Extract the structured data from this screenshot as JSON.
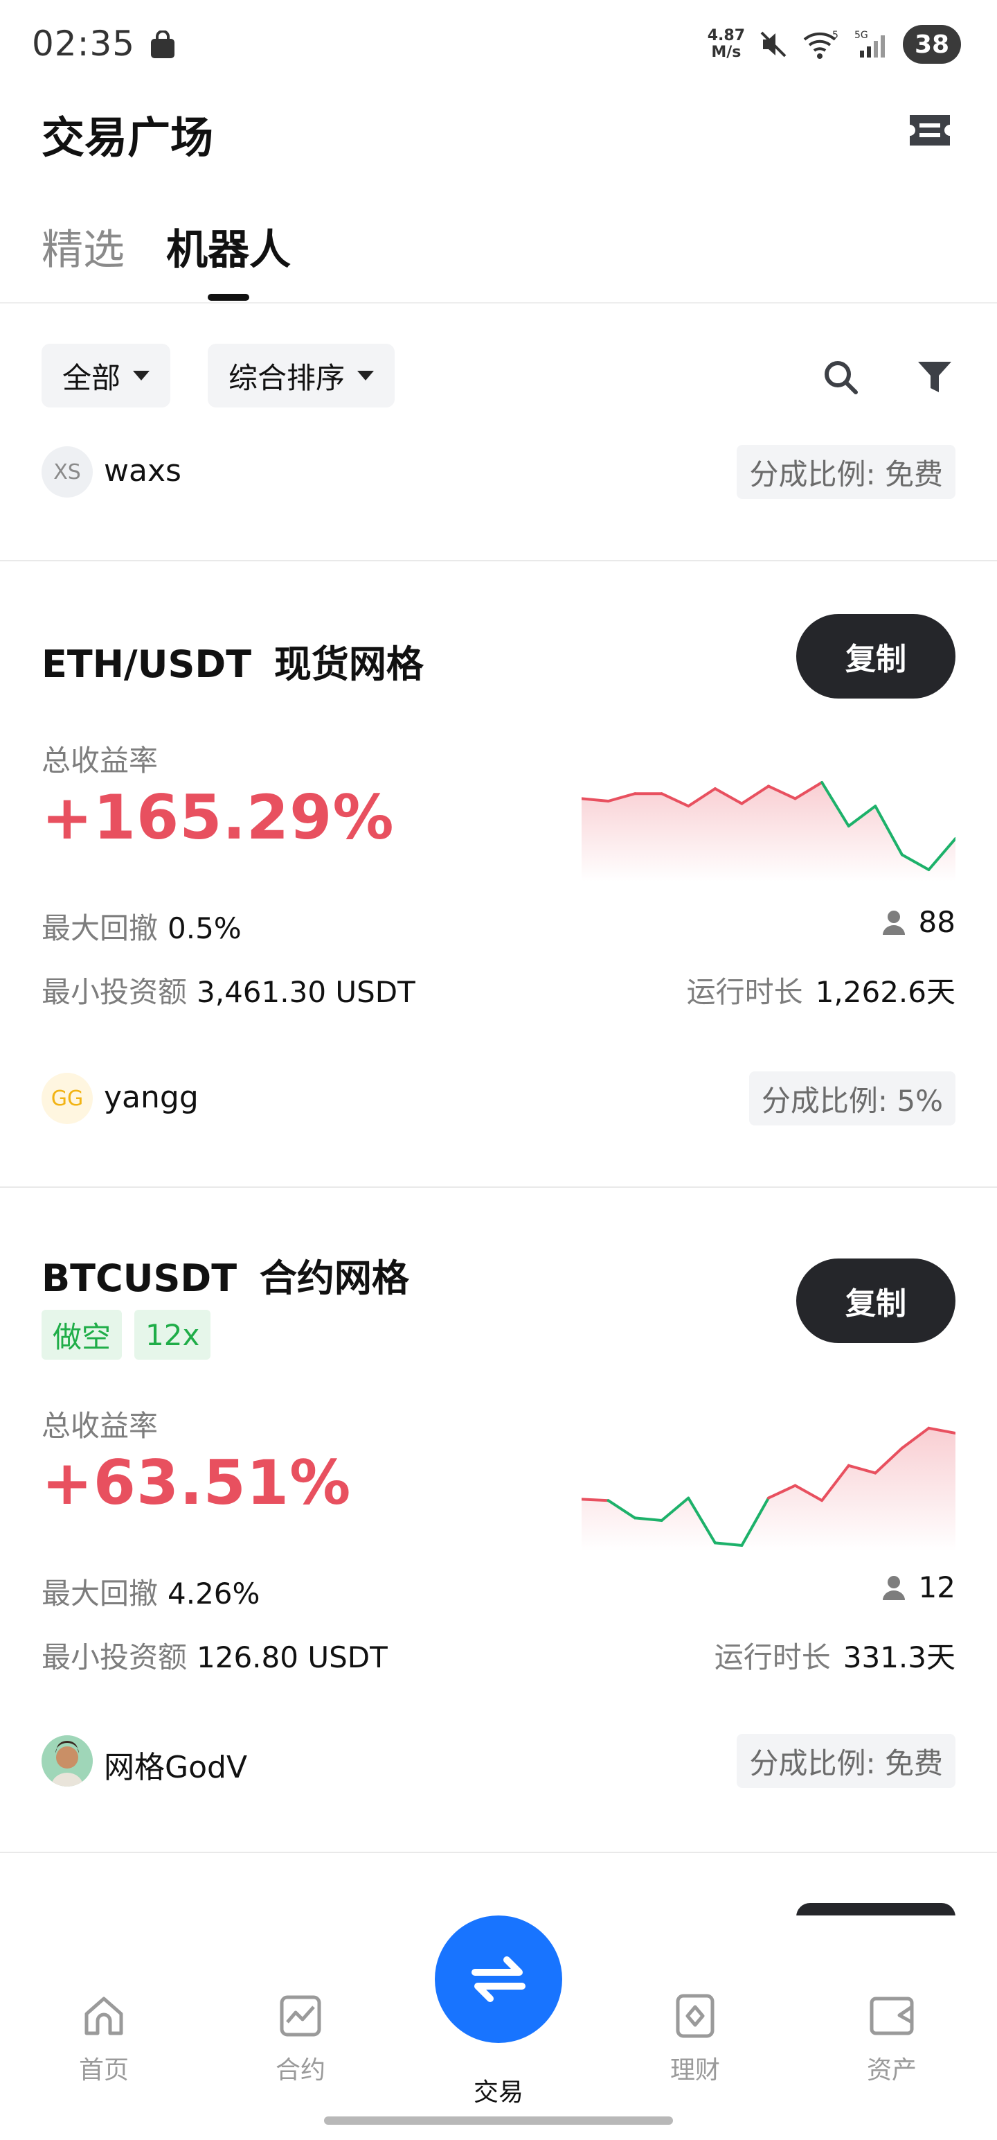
{
  "status_bar": {
    "time": "02:35",
    "net_speed_value": "4.87",
    "net_speed_unit": "M/s",
    "battery": "38"
  },
  "header": {
    "title": "交易广场"
  },
  "tabs": [
    {
      "label": "精选"
    },
    {
      "label": "机器人"
    }
  ],
  "filters": {
    "category": "全部",
    "sort": "综合排序"
  },
  "top_user": {
    "avatar_text": "XS",
    "name": "waxs",
    "share": "分成比例: 免费"
  },
  "cards": [
    {
      "pair": "ETH/USDT",
      "type": "现货网格",
      "copy_label": "复制",
      "roi_label": "总收益率",
      "roi": "+165.29%",
      "max_drawdown_label": "最大回撤",
      "max_drawdown": "0.5%",
      "followers": "88",
      "min_invest_label": "最小投资额",
      "min_invest": "3,461.30 USDT",
      "runtime_label": "运行时长",
      "runtime": "1,262.6天",
      "user_avatar_text": "GG",
      "user_name": "yangg",
      "share": "分成比例: 5%",
      "sparkline": [
        0.62,
        0.6,
        0.66,
        0.66,
        0.56,
        0.7,
        0.58,
        0.72,
        0.62,
        0.75,
        0.4,
        0.56,
        0.17,
        0.05,
        0.3
      ]
    },
    {
      "pair": "BTCUSDT",
      "type": "合约网格",
      "side": "做空",
      "leverage": "12x",
      "copy_label": "复制",
      "roi_label": "总收益率",
      "roi": "+63.51%",
      "max_drawdown_label": "最大回撤",
      "max_drawdown": "4.26%",
      "followers": "12",
      "min_invest_label": "最小投资额",
      "min_invest": "126.80 USDT",
      "runtime_label": "运行时长",
      "runtime": "331.3天",
      "user_name": "网格GodV",
      "share": "分成比例: 免费",
      "sparkline": [
        0.37,
        0.36,
        0.22,
        0.2,
        0.38,
        0.02,
        0.0,
        0.38,
        0.48,
        0.36,
        0.64,
        0.58,
        0.78,
        0.94,
        0.9
      ]
    }
  ],
  "bottom_nav": [
    {
      "label": "首页",
      "icon": "home-icon"
    },
    {
      "label": "合约",
      "icon": "chart-icon"
    },
    {
      "label": "交易",
      "icon": "swap-arrows-icon"
    },
    {
      "label": "理财",
      "icon": "diamond-card-icon"
    },
    {
      "label": "资产",
      "icon": "wallet-icon"
    }
  ],
  "colors": {
    "positive": "#e8505f",
    "negative": "#1db16a",
    "accent": "#1874ff",
    "tag_bg": "#e6f6ea",
    "tag_fg": "#1fad48"
  }
}
